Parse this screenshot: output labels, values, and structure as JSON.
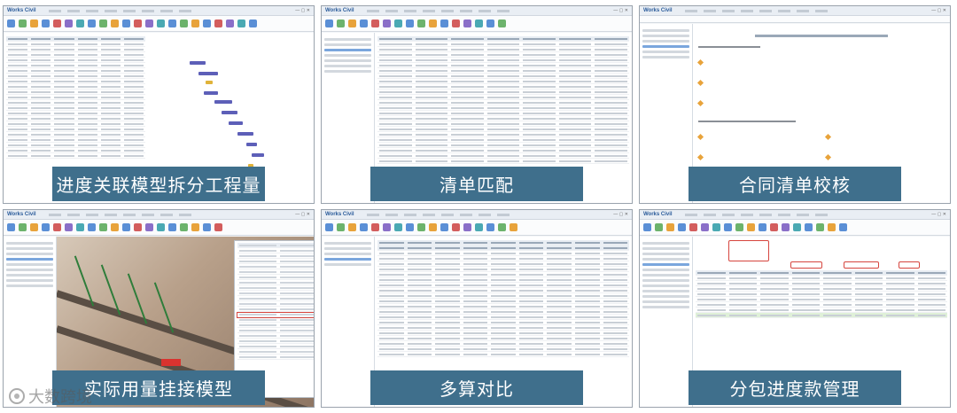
{
  "app": {
    "logo": "Works Civil"
  },
  "panels": [
    {
      "id": "p1",
      "caption": "进度关联模型拆分工程量"
    },
    {
      "id": "p2",
      "caption": "清单匹配"
    },
    {
      "id": "p3",
      "caption": "合同清单校核"
    },
    {
      "id": "p4",
      "caption": "实际用量挂接模型"
    },
    {
      "id": "p5",
      "caption": "多算对比"
    },
    {
      "id": "p6",
      "caption": "分包进度款管理"
    }
  ],
  "watermark": "大数跨境",
  "colors": {
    "caption_bg": "#3f6f8c",
    "highlight_red": "#d6453e",
    "gantt_bar": "#5d5fb8",
    "row_highlight": "#dff0d8"
  }
}
